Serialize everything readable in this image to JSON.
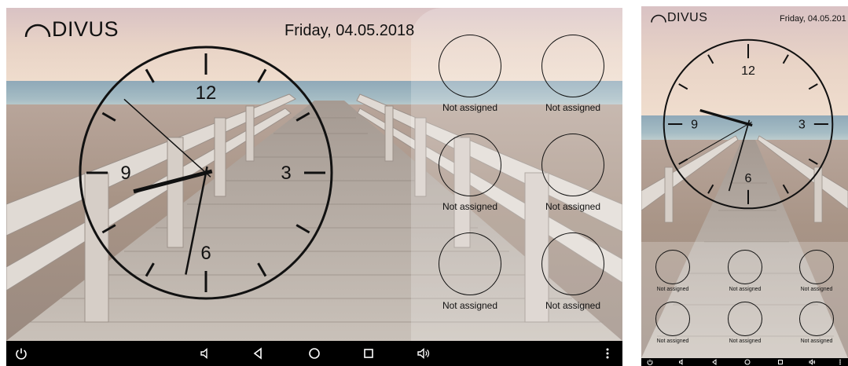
{
  "brand": {
    "name": "DIVUS"
  },
  "date_text": "Friday, 04.05.2018",
  "date_text_portrait": "Friday, 04.05.201",
  "clock": {
    "numerals": [
      "12",
      "3",
      "6",
      "9"
    ],
    "time": {
      "hour": 8,
      "minute": 31,
      "second": 52
    }
  },
  "clock_portrait": {
    "numerals": [
      "12",
      "3",
      "6",
      "9"
    ],
    "time": {
      "hour": 9,
      "minute": 32,
      "second": 40
    }
  },
  "scene_buttons": [
    {
      "label": "Not assigned"
    },
    {
      "label": "Not assigned"
    },
    {
      "label": "Not assigned"
    },
    {
      "label": "Not assigned"
    },
    {
      "label": "Not assigned"
    },
    {
      "label": "Not assigned"
    }
  ],
  "scene_buttons_portrait": [
    {
      "label": "Not assigned"
    },
    {
      "label": "Not assigned"
    },
    {
      "label": "Not assigned"
    },
    {
      "label": "Not assigned"
    },
    {
      "label": "Not assigned"
    },
    {
      "label": "Not assigned"
    }
  ],
  "navbar": {
    "icons": [
      "power-icon",
      "volume-down-icon",
      "back-icon",
      "home-icon",
      "recents-icon",
      "volume-up-icon",
      "more-icon"
    ],
    "glyphs": {
      "power": "⏻",
      "vol_down": "◁",
      "back": "◁",
      "home": "○",
      "recents": "□",
      "vol_up": "◁",
      "more": "⋮"
    }
  },
  "colors": {
    "navbar": "#000000",
    "ink": "#111111"
  }
}
